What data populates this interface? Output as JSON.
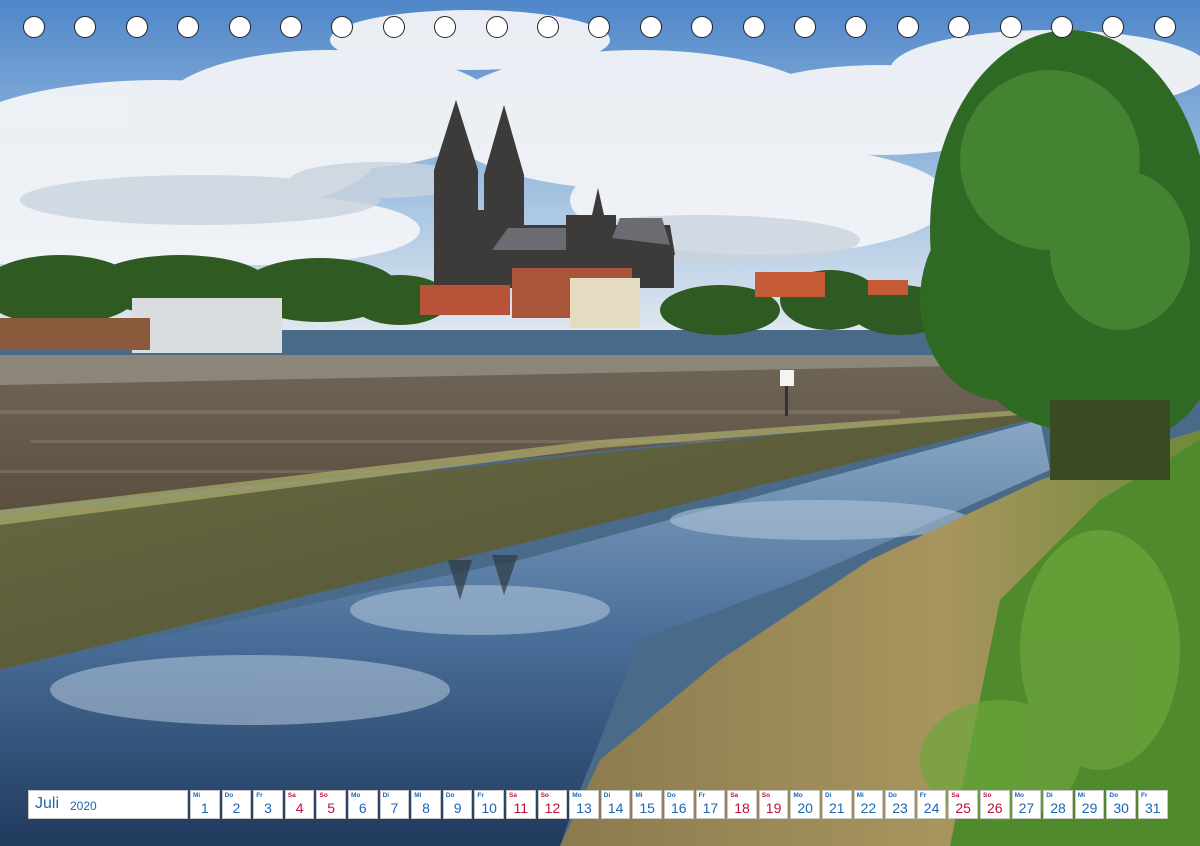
{
  "calendar": {
    "month": "Juli",
    "year": "2020",
    "days": [
      {
        "wd": "Mi",
        "num": "1",
        "weekend": false
      },
      {
        "wd": "Do",
        "num": "2",
        "weekend": false
      },
      {
        "wd": "Fr",
        "num": "3",
        "weekend": false
      },
      {
        "wd": "Sa",
        "num": "4",
        "weekend": true
      },
      {
        "wd": "So",
        "num": "5",
        "weekend": true
      },
      {
        "wd": "Mo",
        "num": "6",
        "weekend": false
      },
      {
        "wd": "Di",
        "num": "7",
        "weekend": false
      },
      {
        "wd": "Mi",
        "num": "8",
        "weekend": false
      },
      {
        "wd": "Do",
        "num": "9",
        "weekend": false
      },
      {
        "wd": "Fr",
        "num": "10",
        "weekend": false
      },
      {
        "wd": "Sa",
        "num": "11",
        "weekend": true
      },
      {
        "wd": "So",
        "num": "12",
        "weekend": true
      },
      {
        "wd": "Mo",
        "num": "13",
        "weekend": false
      },
      {
        "wd": "Di",
        "num": "14",
        "weekend": false
      },
      {
        "wd": "Mi",
        "num": "15",
        "weekend": false
      },
      {
        "wd": "Do",
        "num": "16",
        "weekend": false
      },
      {
        "wd": "Fr",
        "num": "17",
        "weekend": false
      },
      {
        "wd": "Sa",
        "num": "18",
        "weekend": true
      },
      {
        "wd": "So",
        "num": "19",
        "weekend": true
      },
      {
        "wd": "Mo",
        "num": "20",
        "weekend": false
      },
      {
        "wd": "Di",
        "num": "21",
        "weekend": false
      },
      {
        "wd": "Mi",
        "num": "22",
        "weekend": false
      },
      {
        "wd": "Do",
        "num": "23",
        "weekend": false
      },
      {
        "wd": "Fr",
        "num": "24",
        "weekend": false
      },
      {
        "wd": "Sa",
        "num": "25",
        "weekend": true
      },
      {
        "wd": "So",
        "num": "26",
        "weekend": true
      },
      {
        "wd": "Mo",
        "num": "27",
        "weekend": false
      },
      {
        "wd": "Di",
        "num": "28",
        "weekend": false
      },
      {
        "wd": "Mi",
        "num": "29",
        "weekend": false
      },
      {
        "wd": "Do",
        "num": "30",
        "weekend": false
      },
      {
        "wd": "Fr",
        "num": "31",
        "weekend": false
      }
    ]
  },
  "colors": {
    "weekday_text": "#1a66b3",
    "weekend_text": "#c0103a"
  },
  "photo": {
    "binding_hole_count": 23
  }
}
